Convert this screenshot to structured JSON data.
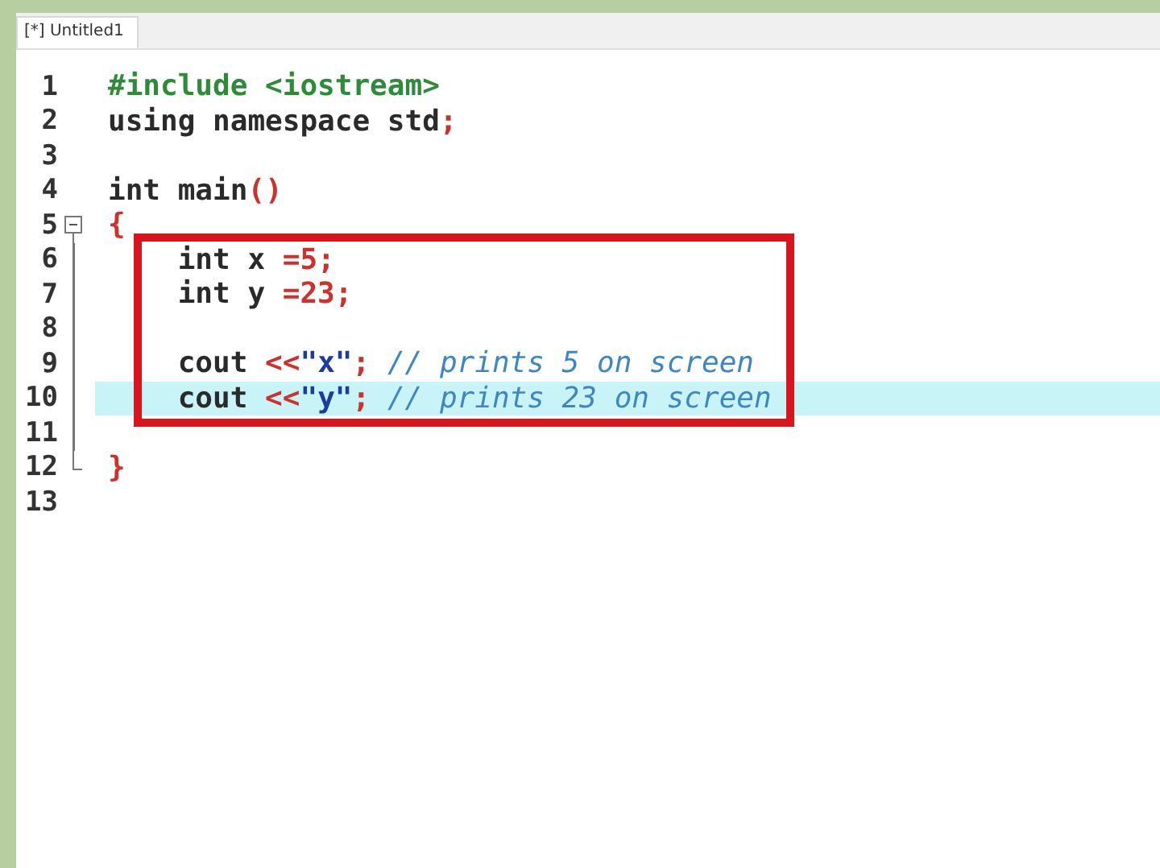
{
  "tabs": [
    {
      "label": "[*] Untitled1",
      "selected": true
    }
  ],
  "lines": [
    {
      "number": "1",
      "tokens": [
        {
          "kind": "preproc",
          "text": "#include <iostream>"
        }
      ]
    },
    {
      "number": "2",
      "tokens": [
        {
          "kind": "plain",
          "text": "using namespace std"
        },
        {
          "kind": "op",
          "text": ";"
        }
      ]
    },
    {
      "number": "3"
    },
    {
      "number": "4",
      "tokens": [
        {
          "kind": "plain",
          "text": "int main"
        },
        {
          "kind": "op",
          "text": "()"
        }
      ]
    },
    {
      "number": "5",
      "fold_start": true,
      "tokens": [
        {
          "kind": "op",
          "text": "{"
        }
      ]
    },
    {
      "number": "6",
      "fold_inside": true,
      "boxed": true,
      "tokens": [
        {
          "kind": "plain",
          "text": "    int x "
        },
        {
          "kind": "op",
          "text": "=5;"
        }
      ]
    },
    {
      "number": "7",
      "fold_inside": true,
      "boxed": true,
      "tokens": [
        {
          "kind": "plain",
          "text": "    int y "
        },
        {
          "kind": "op",
          "text": "=23;"
        }
      ]
    },
    {
      "number": "8",
      "fold_inside": true,
      "boxed": true
    },
    {
      "number": "9",
      "fold_inside": true,
      "boxed": true,
      "tokens": [
        {
          "kind": "plain",
          "text": "    cout "
        },
        {
          "kind": "op",
          "text": "<<"
        },
        {
          "kind": "string",
          "text": "\"x\""
        },
        {
          "kind": "op",
          "text": "; "
        },
        {
          "kind": "comment",
          "text": "// prints 5 on screen"
        }
      ]
    },
    {
      "number": "10",
      "fold_inside": true,
      "boxed": true,
      "current": true,
      "tokens": [
        {
          "kind": "plain",
          "text": "    cout "
        },
        {
          "kind": "op",
          "text": "<<"
        },
        {
          "kind": "string",
          "text": "\"y\""
        },
        {
          "kind": "op",
          "text": "; "
        },
        {
          "kind": "comment",
          "text": "// prints 23 on screen"
        }
      ]
    },
    {
      "number": "11",
      "fold_inside": true
    },
    {
      "number": "12",
      "fold_end": true,
      "tokens": [
        {
          "kind": "op",
          "text": "}"
        }
      ]
    },
    {
      "number": "13"
    }
  ]
}
